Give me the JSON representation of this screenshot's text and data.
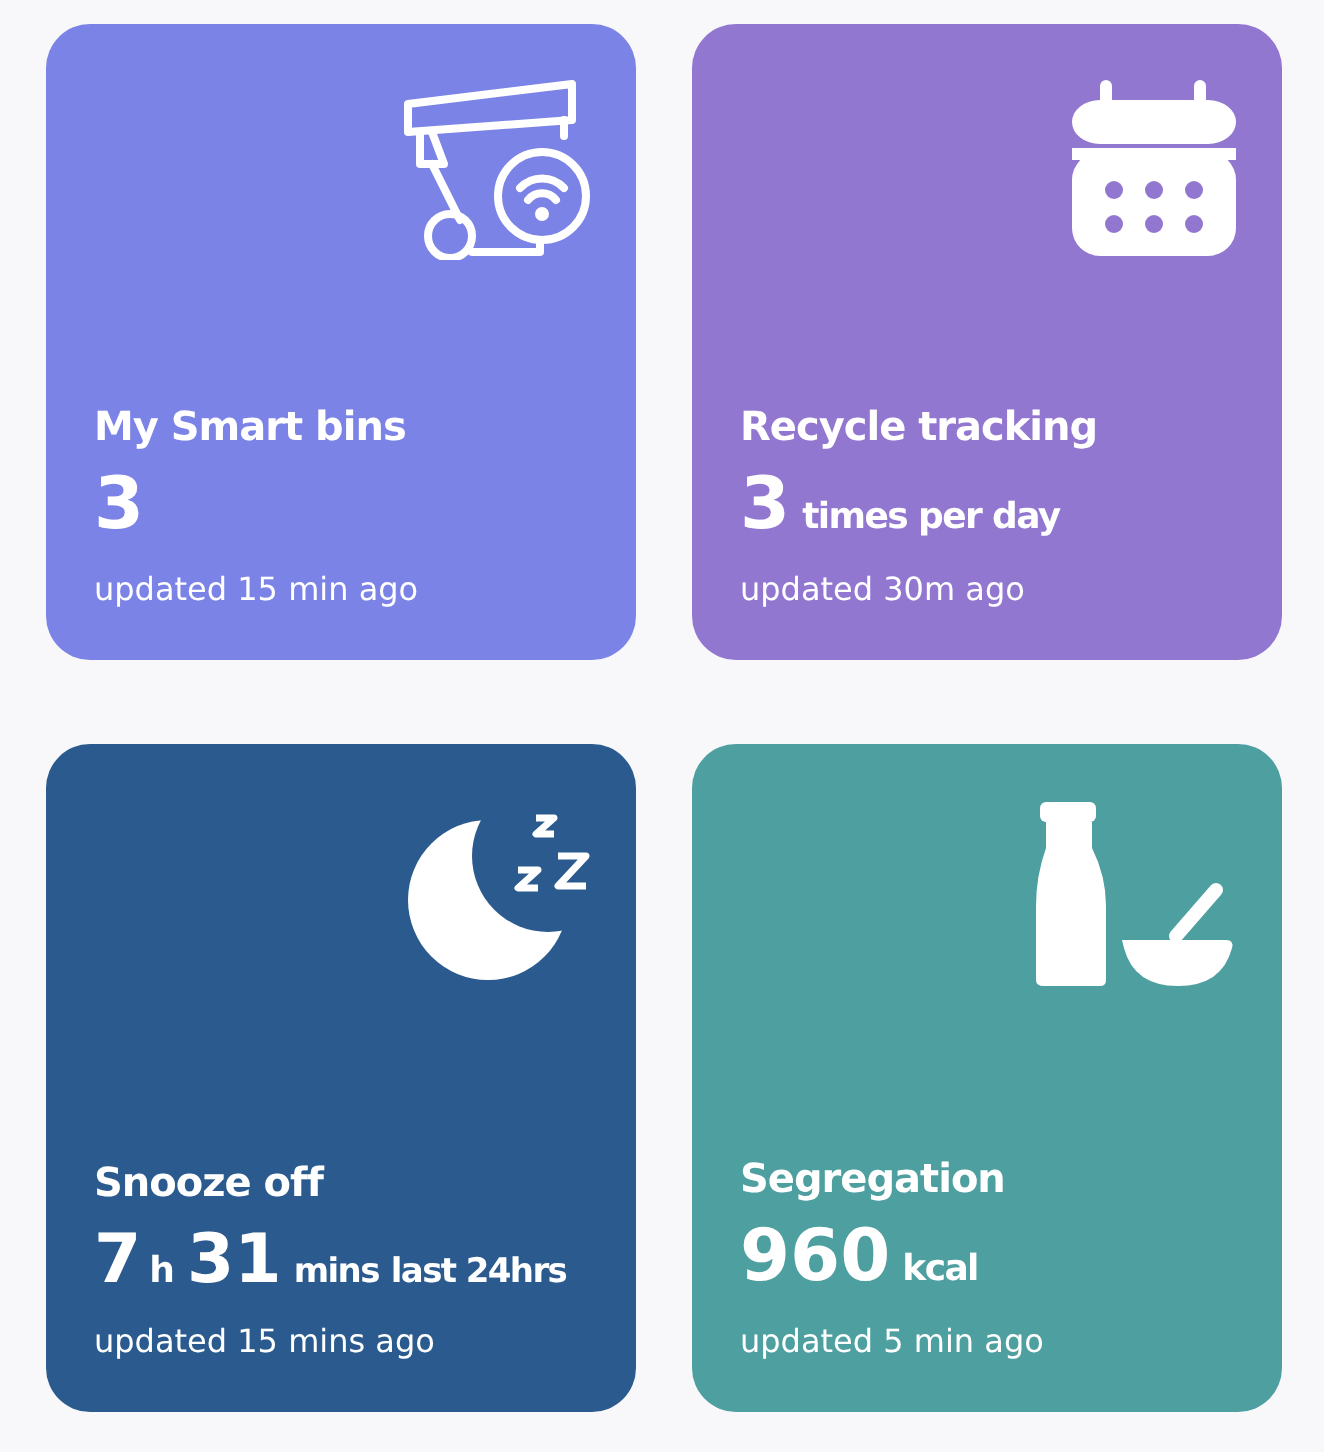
{
  "cards": [
    {
      "kind": "bin",
      "color": "#7b83e6",
      "title": "My Smart bins",
      "value": [
        {
          "kind": "big",
          "text": "3"
        }
      ],
      "updated": "updated 15 min ago"
    },
    {
      "kind": "calendar",
      "color": "#9277d1",
      "title": "Recycle tracking",
      "value": [
        {
          "kind": "big",
          "text": "3"
        },
        {
          "kind": "unit",
          "text": "times per day"
        }
      ],
      "updated": "updated 30m ago"
    },
    {
      "kind": "moon",
      "color": "#2b5b8e",
      "title": "Snooze off",
      "value": [
        {
          "kind": "big",
          "text": "7"
        },
        {
          "kind": "small",
          "text": "h"
        },
        {
          "kind": "big",
          "text": "31"
        },
        {
          "kind": "unit",
          "text": "mins"
        },
        {
          "kind": "unit",
          "text": "last 24hrs"
        }
      ],
      "updated": "updated 15 mins ago"
    },
    {
      "kind": "bottle",
      "color": "#4e9fa0",
      "title": "Segregation",
      "value": [
        {
          "kind": "big",
          "text": "960"
        },
        {
          "kind": "unit",
          "text": "kcal"
        }
      ],
      "updated": "updated 5 min ago"
    }
  ]
}
